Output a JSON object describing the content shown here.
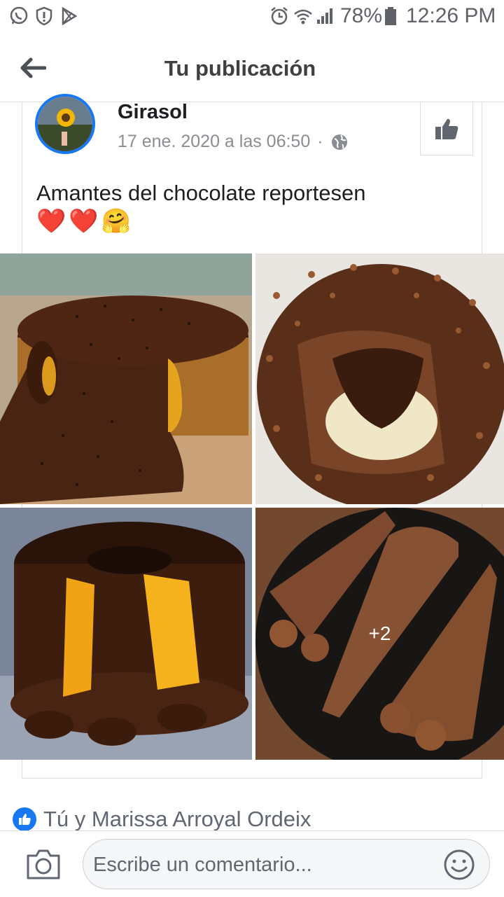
{
  "status_bar": {
    "battery": "78%",
    "time": "12:26 PM"
  },
  "header": {
    "title": "Tu publicación"
  },
  "post": {
    "author": "Girasol",
    "timestamp": "17 ene. 2020 a las 06:50",
    "separator": "·",
    "text": "Amantes del chocolate reportesen",
    "emojis": [
      "❤️",
      "❤️",
      "🤗"
    ],
    "more_photos": "+2"
  },
  "reactions": {
    "text": "Tú y Marissa Arroyal Ordeix"
  },
  "comment": {
    "placeholder": "Escribe un comentario..."
  },
  "colors": {
    "accent": "#1877f2",
    "chocolate": "#4a2a17"
  }
}
